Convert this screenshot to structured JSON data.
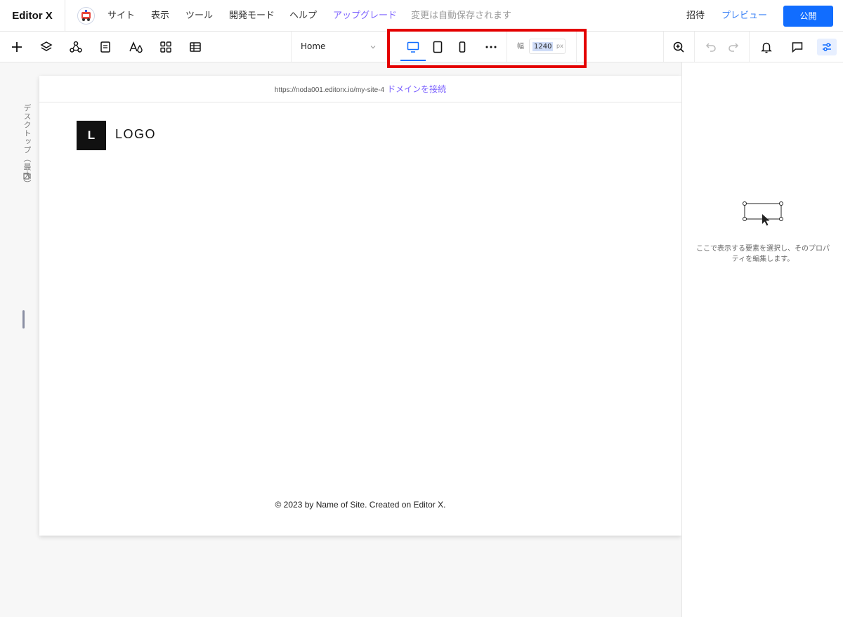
{
  "header": {
    "brand": "Editor X",
    "menu": [
      "サイト",
      "表示",
      "ツール",
      "開発モード",
      "ヘルプ"
    ],
    "upgrade": "アップグレード",
    "autosave": "変更は自動保存されます",
    "invite": "招待",
    "preview": "プレビュー",
    "publish": "公開"
  },
  "toolbar": {
    "page": "Home",
    "width_label": "幅",
    "width_value": "1240",
    "width_unit": "px",
    "more": "···"
  },
  "ruler": {
    "breakpoint_label": "デスクトップ（最大）"
  },
  "canvas": {
    "url": "https://noda001.editorx.io/my-site-4",
    "connect_domain": "ドメインを接続",
    "logo_letter": "L",
    "logo_text": "LOGO",
    "footer": "© 2023 by Name of Site. Created on Editor X."
  },
  "inspector": {
    "empty_text": "ここで表示する要素を選択し、そのプロパティを編集します。"
  },
  "colors": {
    "accent": "#116dff",
    "upgrade": "#7b61ff",
    "highlight": "#e40000"
  },
  "icons": [
    "add-icon",
    "layers-icon",
    "connections-icon",
    "pages-icon",
    "theme-icon",
    "apps-icon",
    "table-icon",
    "desktop-icon",
    "tablet-icon",
    "mobile-icon",
    "more-icon",
    "zoom-icon",
    "undo-icon",
    "redo-icon",
    "bell-icon",
    "comment-icon",
    "settings-icon"
  ]
}
